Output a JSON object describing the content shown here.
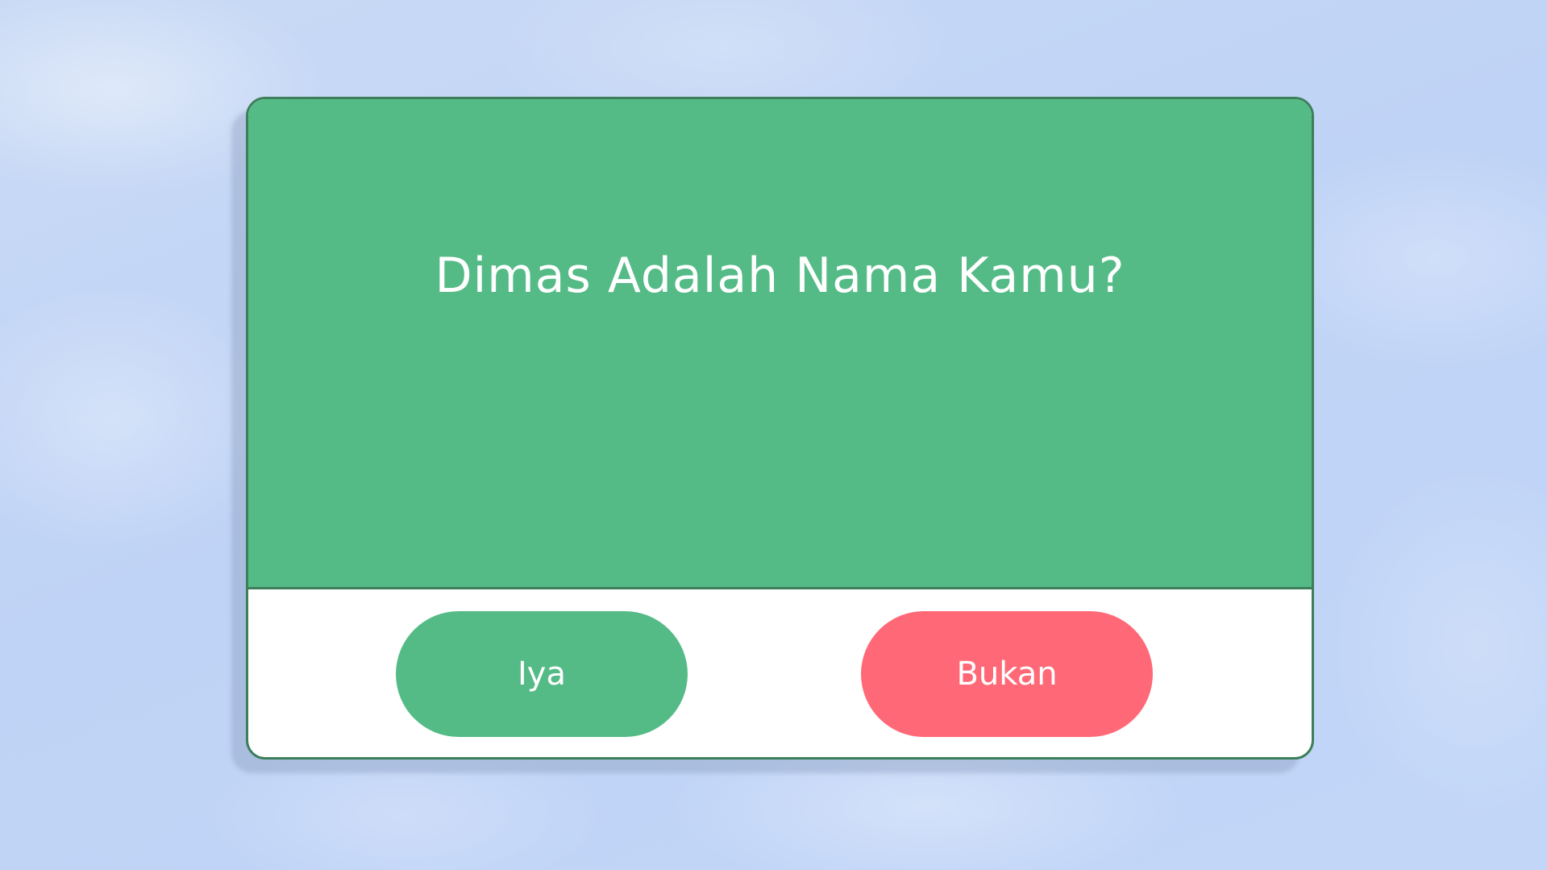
{
  "quiz": {
    "question": "Dimas Adalah Nama Kamu?",
    "answers": {
      "yes_label": "Iya",
      "no_label": "Bukan"
    }
  },
  "colors": {
    "panel_green": "#55bb86",
    "border_green": "#3c7f5a",
    "no_button_red": "#ff6977",
    "background_sky": "#c2d6f6"
  }
}
